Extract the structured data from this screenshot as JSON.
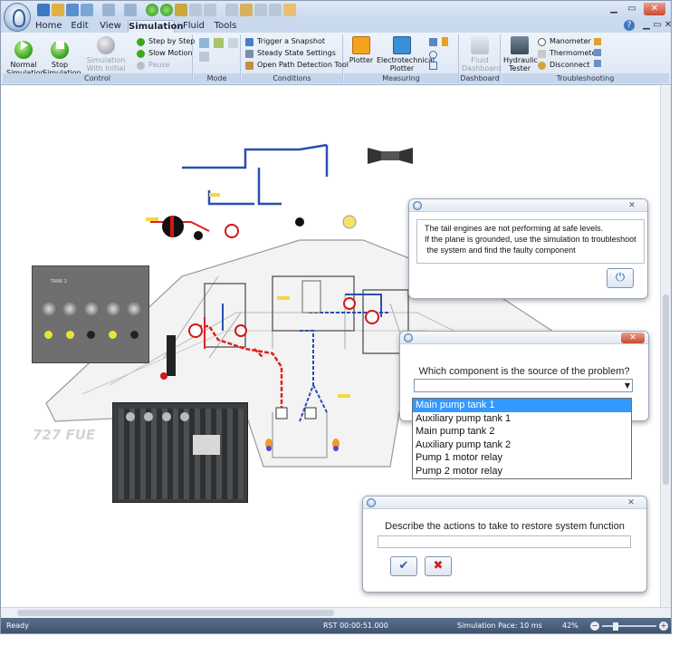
{
  "ribbon": {
    "tabs": [
      "Home",
      "Edit",
      "View",
      "Simulation",
      "Fluid",
      "Tools"
    ],
    "active_tab": "Simulation",
    "control": {
      "label": "Control",
      "normal_simulation": "Normal Simulation",
      "stop_simulation": "Stop Simulation",
      "with_initial_conditions": "Simulation With Initial Conditions",
      "step_by_step": "Step by Step",
      "slow_motion": "Slow Motion",
      "pause": "Pause"
    },
    "mode": {
      "label": "Mode"
    },
    "conditions": {
      "label": "Conditions",
      "trigger_snapshot": "Trigger a Snapshot",
      "steady_state": "Steady State Settings",
      "open_path": "Open Path Detection Tool"
    },
    "measuring": {
      "label": "Measuring",
      "plotter": "Plotter",
      "electrotechnical_plotter": "Electrotechnical Plotter"
    },
    "dashboard": {
      "label": "Dashboard",
      "fluid_dashboard": "Fluid Dashboard"
    },
    "troubleshooting": {
      "label": "Troubleshooting",
      "hydraulic_tester": "Hydraulic Tester",
      "manometer": "Manometer",
      "thermometer": "Thermometer",
      "disconnect": "Disconnect"
    }
  },
  "diagram": {
    "watermark": "727 FUE",
    "panel_title": "TANK 2"
  },
  "dialog_info": {
    "lines": [
      "The tail engines are not performing at safe levels.",
      "If the plane is grounded, use the simulation to troubleshoot",
      " the system and find the faulty component"
    ],
    "close": "✕"
  },
  "dialog_question": {
    "question": "Which component is the source of the problem?",
    "options": [
      "Main pump tank 1",
      "Auxiliary pump tank 1",
      "Main pump tank 2",
      "Auxiliary pump tank 2",
      "Pump 1 motor relay",
      "Pump 2 motor relay"
    ],
    "selected_index": 0,
    "close": "✕"
  },
  "dialog_actions": {
    "prompt": "Describe the actions to take to restore system function",
    "input_value": "",
    "ok": "✔",
    "cancel": "✖",
    "close": "✕"
  },
  "status": {
    "ready": "Ready",
    "rst": "RST 00:00:51.000",
    "pace": "Simulation Pace: 10 ms",
    "zoom": "42%"
  },
  "colors": {
    "ribbon_bg": "#dbe6f4",
    "status_bg": "#3e526e",
    "selection": "#3399ff",
    "pipe_red": "#e02020",
    "pipe_blue": "#2a4fb0"
  }
}
